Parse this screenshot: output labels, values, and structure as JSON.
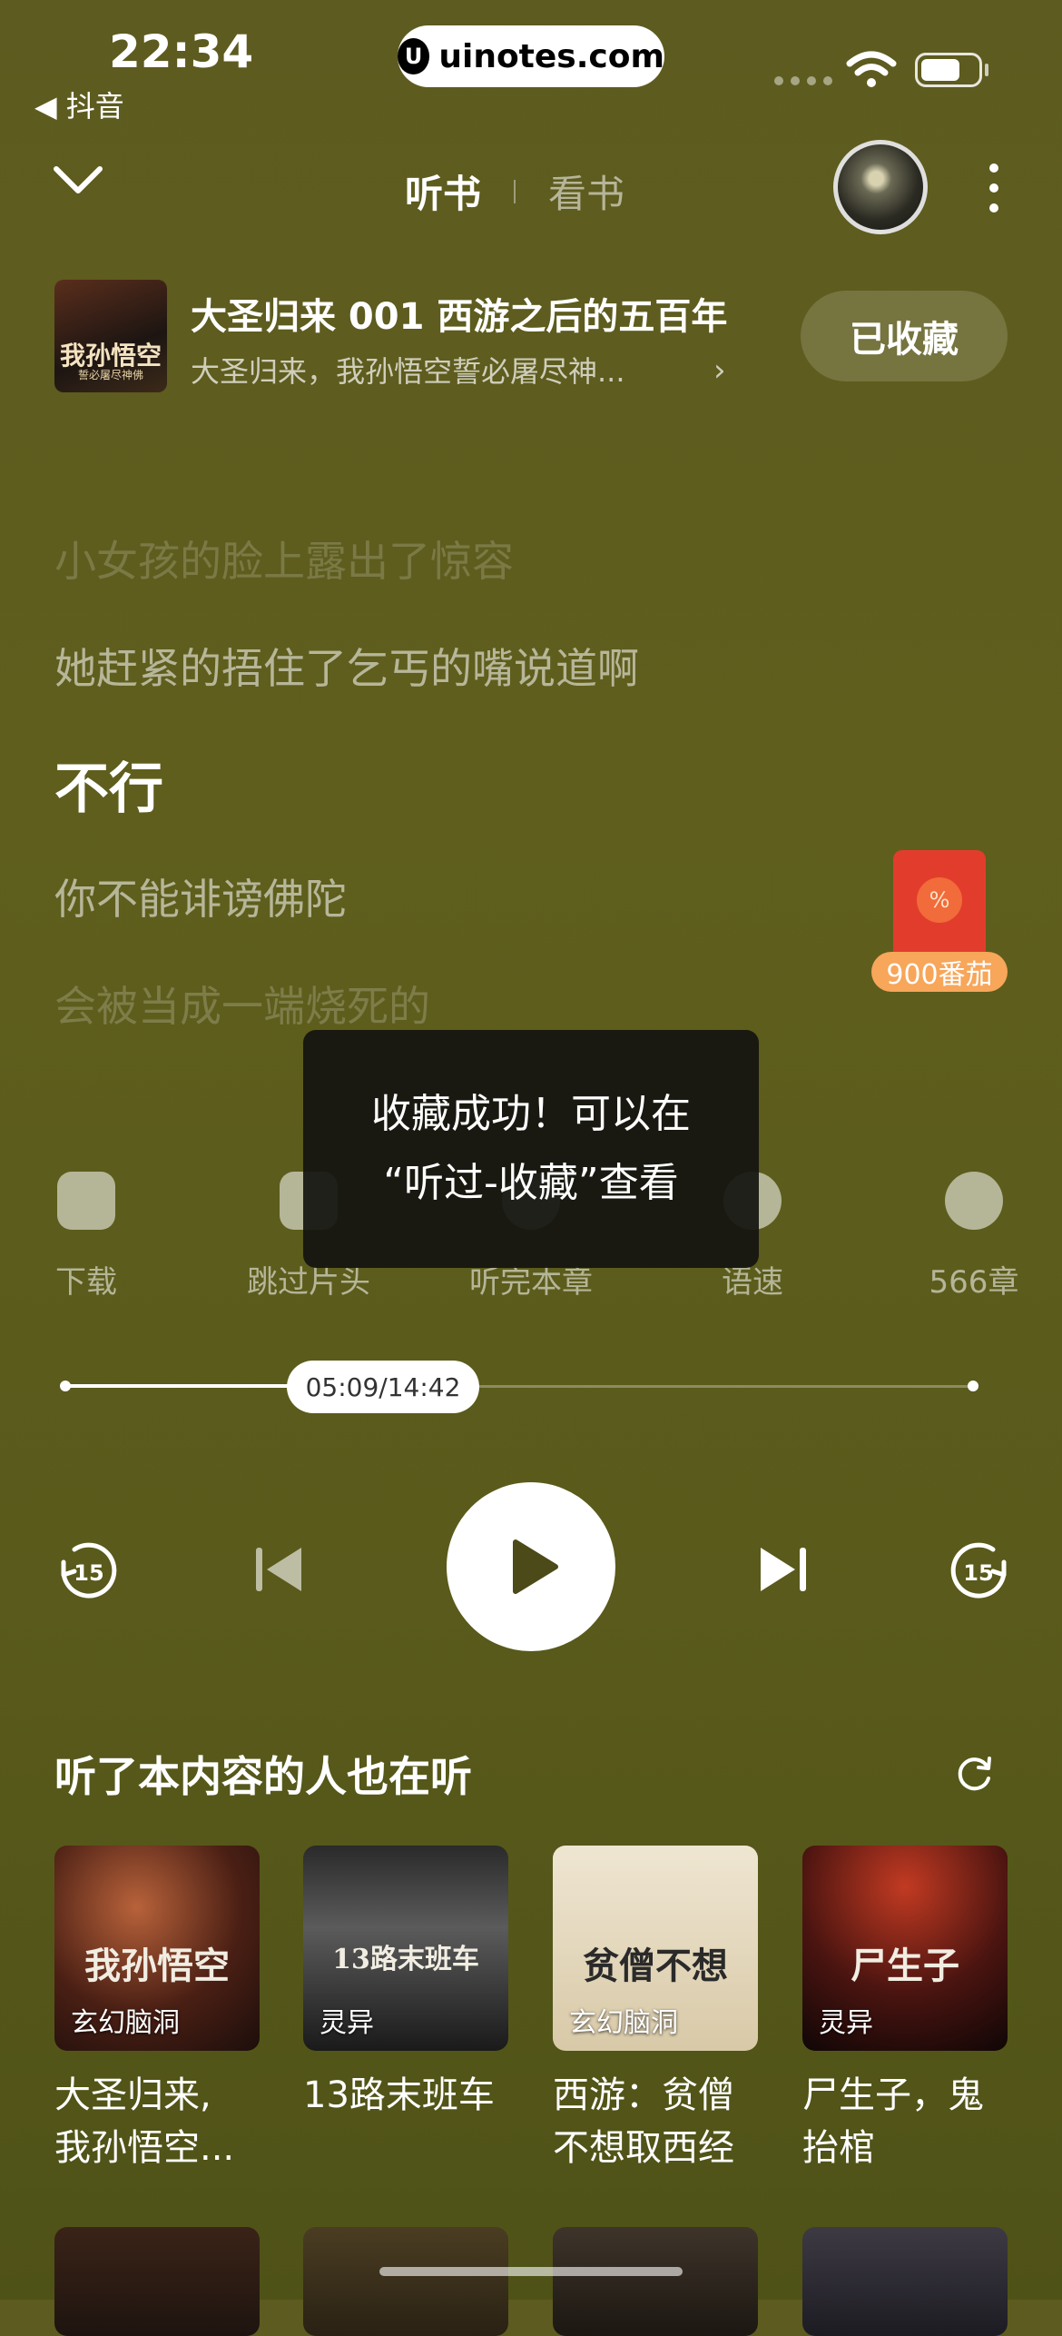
{
  "status_bar": {
    "time": "22:34",
    "back_app": "◀ 抖音",
    "url": "uinotes.com",
    "url_logo": "U"
  },
  "top_bar": {
    "tab_listen": "听书",
    "tab_read": "看书",
    "active_tab": "听书"
  },
  "book": {
    "cover_title": "我孙悟空",
    "cover_subtitle": "誓必屠尽神佛",
    "episode_title": "大圣归来 001 西游之后的五百年",
    "description": "大圣归来，我孙悟空誓必屠尽神...",
    "chevron": "›",
    "collect_label": "已收藏"
  },
  "lyrics": [
    "小女孩的脸上露出了惊容",
    "她赶紧的捂住了乞丐的嘴说道啊",
    "不行",
    "你不能诽谤佛陀",
    "会被当成一端烧死的"
  ],
  "reward": {
    "label": "900番茄",
    "coin_glyph": "%"
  },
  "tools": {
    "download": "下载",
    "skip_intro": "跳过片头",
    "finish_chapter": "听完本章",
    "speed": "语速",
    "chapters": "566章"
  },
  "toast": {
    "line1": "收藏成功！可以在",
    "line2": "“听过-收藏”查看"
  },
  "player": {
    "time_display": "05:09/14:42",
    "played_fraction": 0.351,
    "rewind_label": "15",
    "forward_label": "15"
  },
  "recommend": {
    "title": "听了本内容的人也在听",
    "items": [
      {
        "cover_text": "我孙悟空",
        "tag": "玄幻脑洞",
        "name_line1": "大圣归来,",
        "name_line2": "我孙悟空..."
      },
      {
        "cover_text": "13路末班车",
        "tag": "灵异",
        "name_line1": "13路末班车",
        "name_line2": ""
      },
      {
        "cover_text": "贫僧不想",
        "tag": "玄幻脑洞",
        "name_line1": "西游：贫僧",
        "name_line2": "不想取西经"
      },
      {
        "cover_text": "尸生子",
        "tag": "灵异",
        "name_line1": "尸生子，鬼",
        "name_line2": "抬棺"
      }
    ]
  },
  "colors": {
    "background": "#5d5b1f",
    "red_packet": "#e23d2c",
    "reward_label": "#f7a65a"
  },
  "icons": [
    "chevron-down-icon",
    "more-icon",
    "download-icon",
    "skip-icon",
    "timer-icon",
    "speed-icon",
    "chapters-icon",
    "rewind-15-icon",
    "previous-icon",
    "play-icon",
    "next-icon",
    "forward-15-icon",
    "refresh-icon",
    "wifi-icon",
    "battery-icon"
  ]
}
